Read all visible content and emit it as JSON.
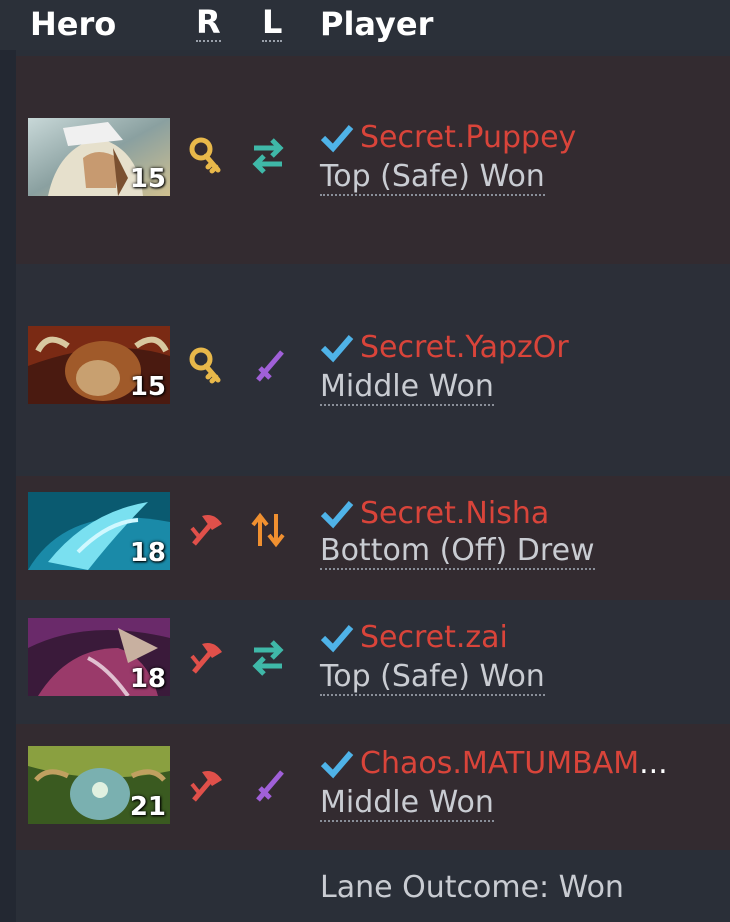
{
  "header": {
    "hero": "Hero",
    "role": "R",
    "lane": "L",
    "player": "Player"
  },
  "rows": [
    {
      "hero_icon": "hero-portrait-1",
      "level": "15",
      "role_icon": "support-key-icon",
      "lane_icon": "lane-swap-icon",
      "player": "Secret.Puppey",
      "lane": "Top (Safe) Won"
    },
    {
      "hero_icon": "hero-portrait-2",
      "level": "15",
      "role_icon": "support-key-icon",
      "lane_icon": "lane-sword-icon",
      "player": "Secret.YapzOr",
      "lane": "Middle Won"
    },
    {
      "hero_icon": "hero-portrait-3",
      "level": "18",
      "role_icon": "core-axe-icon",
      "lane_icon": "lane-updown-icon",
      "player": "Secret.Nisha",
      "lane": "Bottom (Off) Drew"
    },
    {
      "hero_icon": "hero-portrait-4",
      "level": "18",
      "role_icon": "core-axe-icon",
      "lane_icon": "lane-swap-icon",
      "player": "Secret.zai",
      "lane": "Top (Safe) Won"
    },
    {
      "hero_icon": "hero-portrait-5",
      "level": "21",
      "role_icon": "core-axe-icon",
      "lane_icon": "lane-sword-icon",
      "player": "Chaos.MATUMBAM",
      "player_suffix": "...",
      "lane": "Middle Won"
    }
  ],
  "footer": {
    "lane_outcome": "Lane Outcome: Won"
  },
  "colors": {
    "player_name": "#d9443a",
    "check": "#4fb3e8",
    "support": "#e8b84a",
    "core": "#e0504a",
    "lane_teal": "#3fb8a8",
    "lane_purple": "#a060d8",
    "lane_orange": "#f09030"
  }
}
